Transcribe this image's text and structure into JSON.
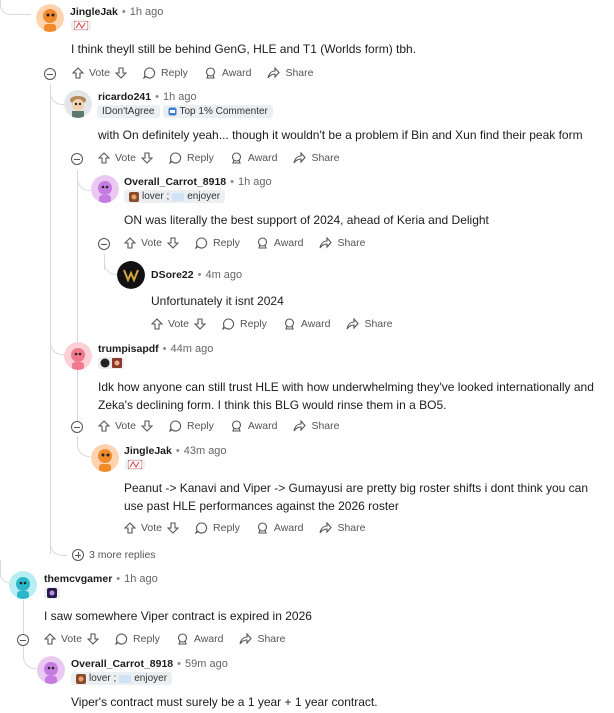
{
  "comments": [
    {
      "user": "JingleJak",
      "time": "1h ago",
      "body": [
        "I think theyll still be behind GenG, HLE and T1 (Worlds form) tbh."
      ]
    },
    {
      "user": "ricardo241",
      "time": "1h ago",
      "flair": [
        "IDon'tAgree",
        "Top 1% Commenter"
      ],
      "body": [
        "with On definitely yeah... though it wouldn't be a problem if Bin and Xun find their peak form"
      ]
    },
    {
      "user": "Overall_Carrot_8918",
      "time": "1h ago",
      "flair": [
        "lover ;",
        "enjoyer"
      ],
      "body": [
        "ON was literally the best support of 2024, ahead of Keria and Delight"
      ]
    },
    {
      "user": "DSore22",
      "time": "4m ago",
      "body": [
        "Unfortunately it isnt 2024"
      ]
    },
    {
      "user": "trumpisapdf",
      "time": "44m ago",
      "body": [
        "Idk how anyone can still trust HLE with how underwhelming they've looked internationally and",
        "Zeka's declining form. I think this BLG would rinse them in a BO5."
      ]
    },
    {
      "user": "JingleJak",
      "time": "43m ago",
      "body": [
        "Peanut -> Kanavi and Viper -> Gumayusi are pretty big roster shifts i dont think you can",
        "use past HLE performances against the 2026 roster"
      ]
    },
    {
      "user": "themcvgamer",
      "time": "1h ago",
      "body": [
        "I saw somewhere Viper contract is expired in 2026"
      ]
    },
    {
      "user": "Overall_Carrot_8918",
      "time": "59m ago",
      "flair": [
        "lover ;",
        "enjoyer"
      ],
      "body": [
        "Viper's contract must surely be a 1 year + 1 year contract."
      ]
    }
  ],
  "actions": {
    "vote": "Vote",
    "reply": "Reply",
    "award": "Award",
    "share": "Share"
  },
  "more_replies": "3 more replies",
  "colors": {
    "accent": "#d93a00",
    "muted": "#576f76"
  }
}
